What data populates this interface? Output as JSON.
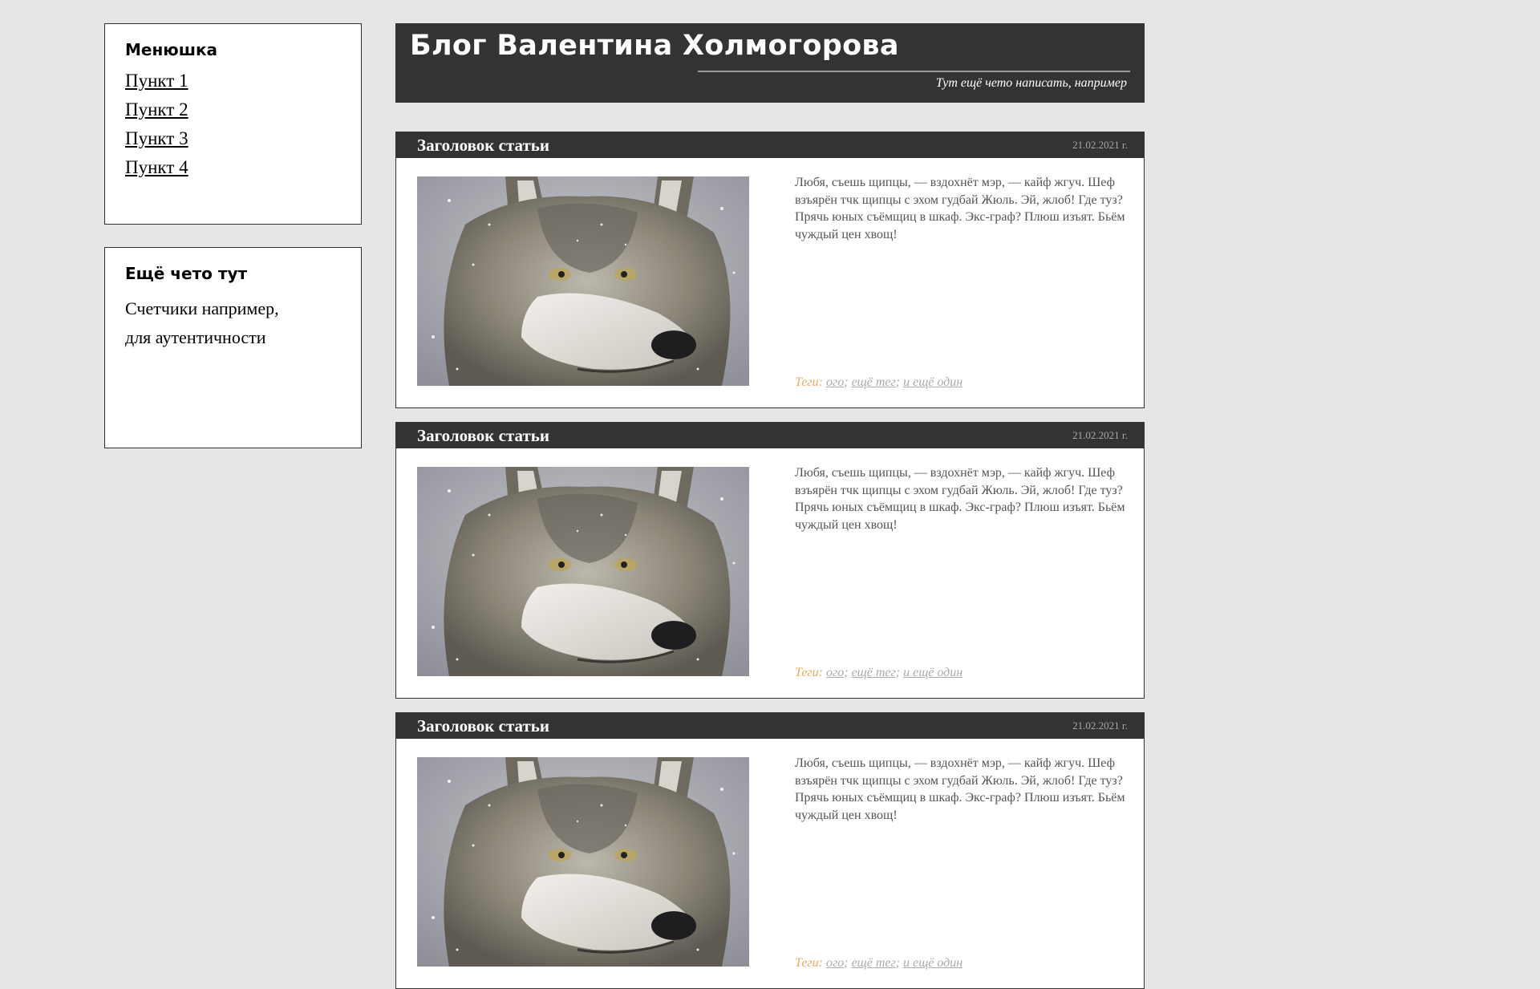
{
  "sidebar": {
    "menu": {
      "title": "Менюшка",
      "items": [
        "Пункт 1",
        "Пункт 2",
        "Пункт 3",
        "Пункт 4"
      ]
    },
    "extra": {
      "title": "Ещё чето тут",
      "line1": "Счетчики например,",
      "line2": "для аутентичности"
    }
  },
  "header": {
    "title": "Блог Валентина Холмогорова",
    "subtitle": "Тут ещё чето написать, например"
  },
  "articles": [
    {
      "title": "Заголовок статьи",
      "date": "21.02.2021 г.",
      "text": "Любя, съешь щипцы, — вздохнёт мэр, — кайф жгуч. Шеф взъярён тчк щипцы с эхом гудбай Жюль. Эй, жлоб! Где туз? Прячь юных съёмщиц в шкаф. Экс-граф? Плюш изъят. Бьём чуждый цен хвощ!",
      "tags_label": "Теги:",
      "tags": [
        "ого",
        "ещё тег",
        "и ещё один"
      ]
    },
    {
      "title": "Заголовок статьи",
      "date": "21.02.2021 г.",
      "text": "Любя, съешь щипцы, — вздохнёт мэр, — кайф жгуч. Шеф взъярён тчк щипцы с эхом гудбай Жюль. Эй, жлоб! Где туз? Прячь юных съёмщиц в шкаф. Экс-граф? Плюш изъят. Бьём чуждый цен хвощ!",
      "tags_label": "Теги:",
      "tags": [
        "ого",
        "ещё тег",
        "и ещё один"
      ]
    },
    {
      "title": "Заголовок статьи",
      "date": "21.02.2021 г.",
      "text": "Любя, съешь щипцы, — вздохнёт мэр, — кайф жгуч. Шеф взъярён тчк щипцы с эхом гудбай Жюль. Эй, жлоб! Где туз? Прячь юных съёмщиц в шкаф. Экс-граф? Плюш изъят. Бьём чуждый цен хвощ!",
      "tags_label": "Теги:",
      "tags": [
        "ого",
        "ещё тег",
        "и ещё один"
      ]
    }
  ],
  "colors": {
    "background": "#e6e6e6",
    "dark": "#333333",
    "tag_label": "#f0a95a",
    "tag_link": "#aaaaaa"
  }
}
